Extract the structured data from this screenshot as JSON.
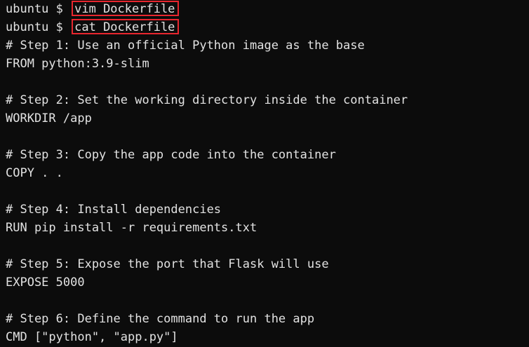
{
  "terminal": {
    "prompt": "ubuntu $",
    "commands": [
      "vim Dockerfile",
      "cat Dockerfile"
    ],
    "highlight_color": "#e8262e",
    "output_lines": [
      "# Step 1: Use an official Python image as the base",
      "FROM python:3.9-slim",
      "",
      "# Step 2: Set the working directory inside the container",
      "WORKDIR /app",
      "",
      "# Step 3: Copy the app code into the container",
      "COPY . .",
      "",
      "# Step 4: Install dependencies",
      "RUN pip install -r requirements.txt",
      "",
      "# Step 5: Expose the port that Flask will use",
      "EXPOSE 5000",
      "",
      "# Step 6: Define the command to run the app",
      "CMD [\"python\", \"app.py\"]"
    ]
  }
}
